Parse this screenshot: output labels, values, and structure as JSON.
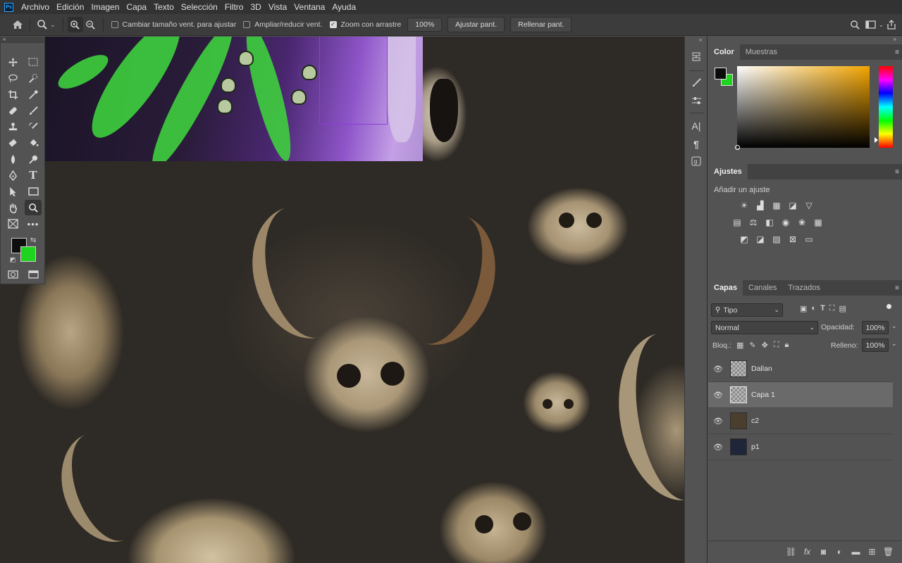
{
  "menu": {
    "logo": "Ps",
    "items": [
      "Archivo",
      "Edición",
      "Imagen",
      "Capa",
      "Texto",
      "Selección",
      "Filtro",
      "3D",
      "Vista",
      "Ventana",
      "Ayuda"
    ]
  },
  "options": {
    "cb_resize": "Cambiar tamaño vent. para ajustar",
    "cb_zoom_all": "Ampliar/reducir vent.",
    "cb_scrubby": "Zoom con arrastre",
    "cb_scrubby_checked": true,
    "zoom_value": "100%",
    "fit_screen": "Ajustar pant.",
    "fill_screen": "Rellenar pant."
  },
  "color_panel": {
    "tabs": [
      "Color",
      "Muestras"
    ],
    "foreground": "#0b0b0b",
    "background": "#1fd41f"
  },
  "adjustments_panel": {
    "tab": "Ajustes",
    "label": "Añadir un ajuste"
  },
  "layers_panel": {
    "tabs": [
      "Capas",
      "Canales",
      "Trazados"
    ],
    "filter": "Tipo",
    "blend_mode": "Normal",
    "opacity_label": "Opacidad:",
    "opacity": "100%",
    "lock_label": "Bloq.:",
    "fill_label": "Relleno:",
    "fill": "100%",
    "layers": [
      {
        "name": "Dallan",
        "visible": true,
        "selected": false
      },
      {
        "name": "Capa 1",
        "visible": true,
        "selected": true
      },
      {
        "name": "c2",
        "visible": true,
        "selected": false
      },
      {
        "name": "p1",
        "visible": true,
        "selected": false
      }
    ]
  }
}
